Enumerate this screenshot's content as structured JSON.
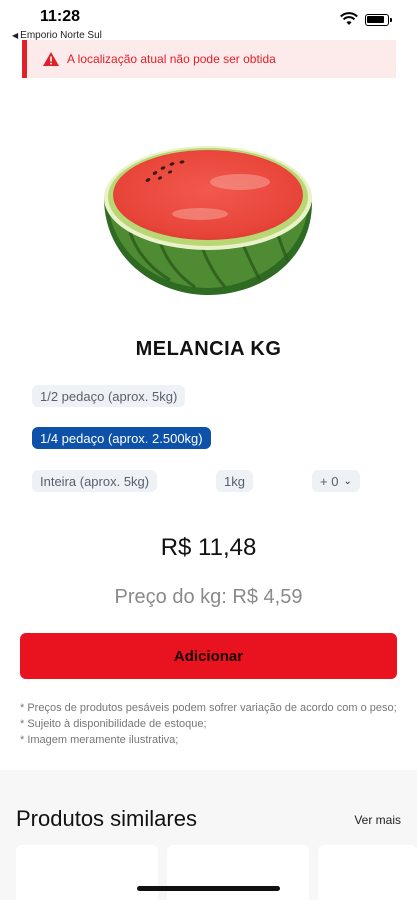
{
  "status_bar": {
    "time": "11:28",
    "back_app": "Emporio Norte Sul"
  },
  "alert": {
    "message": "A localização atual não pode ser obtida",
    "color": "#e0202a"
  },
  "product": {
    "image_icon": "watermelon-icon",
    "title": "MELANCIA KG",
    "options": [
      {
        "label": "1/2 pedaço (aprox. 5kg)",
        "selected": false
      },
      {
        "label": "1/4 pedaço (aprox. 2.500kg)",
        "selected": true
      },
      {
        "label": "Inteira (aprox. 5kg)",
        "selected": false
      },
      {
        "label": "1kg",
        "selected": false
      }
    ],
    "quantity": "+ 0",
    "price": "R$ 11,48",
    "price_per_kg": "Preço do kg: R$ 4,59",
    "add_label": "Adicionar",
    "disclaimer": [
      "* Preços de produtos pesáveis podem sofrer variação de acordo com o peso;",
      "* Sujeito à disponibilidade de estoque;",
      "* Imagem meramente ilustrativa;"
    ]
  },
  "similar": {
    "title": "Produtos similares",
    "see_more": "Ver mais"
  },
  "colors": {
    "accent": "#e8131e",
    "selected_chip": "#0d52a8"
  }
}
